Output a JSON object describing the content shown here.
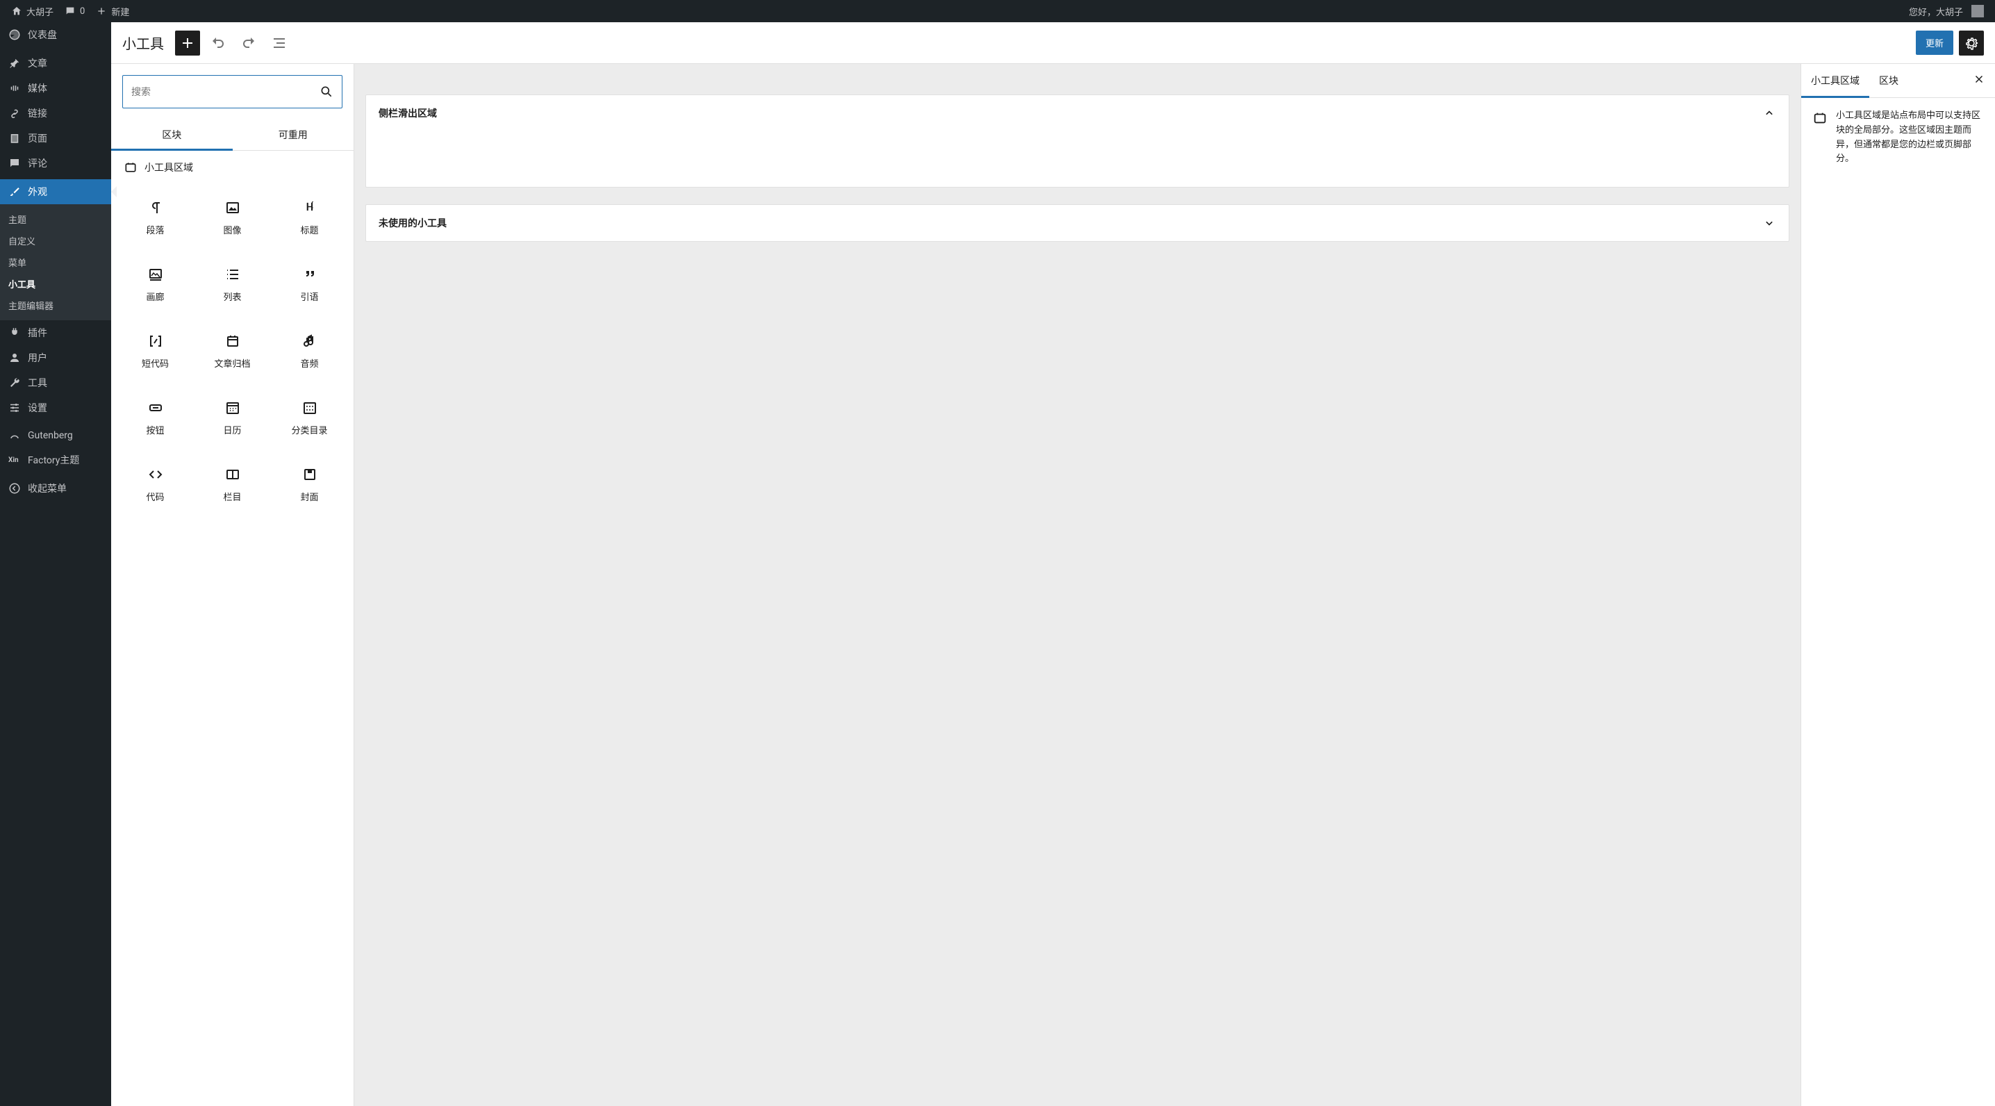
{
  "adminbar": {
    "site_name": "大胡子",
    "comments_count": "0",
    "new_label": "新建",
    "greeting": "您好，大胡子"
  },
  "sidebar": {
    "dashboard": "仪表盘",
    "posts": "文章",
    "media": "媒体",
    "links": "链接",
    "pages": "页面",
    "comments": "评论",
    "appearance": "外观",
    "appearance_sub": {
      "themes": "主题",
      "customize": "自定义",
      "menus": "菜单",
      "widgets": "小工具",
      "theme_editor": "主题编辑器"
    },
    "plugins": "插件",
    "users": "用户",
    "tools": "工具",
    "settings": "设置",
    "gutenberg": "Gutenberg",
    "factory": "Factory主题",
    "collapse": "收起菜单"
  },
  "header": {
    "title": "小工具",
    "update_label": "更新"
  },
  "inserter": {
    "search_placeholder": "搜索",
    "tab_blocks": "区块",
    "tab_reusable": "可重用",
    "category_widget_area": "小工具区域",
    "blocks": [
      {
        "id": "paragraph",
        "label": "段落"
      },
      {
        "id": "image",
        "label": "图像"
      },
      {
        "id": "heading",
        "label": "标题"
      },
      {
        "id": "gallery",
        "label": "画廊"
      },
      {
        "id": "list",
        "label": "列表"
      },
      {
        "id": "quote",
        "label": "引语"
      },
      {
        "id": "shortcode",
        "label": "短代码"
      },
      {
        "id": "archives",
        "label": "文章归档"
      },
      {
        "id": "audio",
        "label": "音频"
      },
      {
        "id": "button",
        "label": "按钮"
      },
      {
        "id": "calendar",
        "label": "日历"
      },
      {
        "id": "categories",
        "label": "分类目录"
      },
      {
        "id": "code",
        "label": "代码"
      },
      {
        "id": "columns",
        "label": "栏目"
      },
      {
        "id": "cover",
        "label": "封面"
      }
    ]
  },
  "canvas": {
    "area1_title": "侧栏滑出区域",
    "area2_title": "未使用的小工具"
  },
  "settings_panel": {
    "tab_area": "小工具区域",
    "tab_block": "区块",
    "description": "小工具区域是站点布局中可以支持区块的全局部分。这些区域因主题而异，但通常都是您的边栏或页脚部分。"
  }
}
